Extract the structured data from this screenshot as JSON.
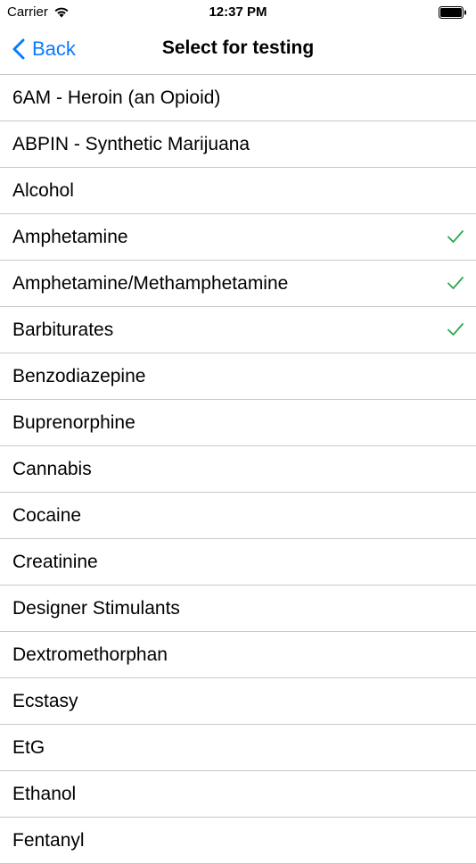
{
  "status_bar": {
    "carrier": "Carrier",
    "time": "12:37 PM"
  },
  "nav": {
    "back_label": "Back",
    "title": "Select for testing"
  },
  "colors": {
    "accent": "#0a7aff",
    "check": "#2aa84a",
    "separator": "#c8c7cc"
  },
  "items": [
    {
      "label": "6AM - Heroin (an Opioid)",
      "selected": false
    },
    {
      "label": "ABPIN - Synthetic Marijuana",
      "selected": false
    },
    {
      "label": "Alcohol",
      "selected": false
    },
    {
      "label": "Amphetamine",
      "selected": true
    },
    {
      "label": "Amphetamine/Methamphetamine",
      "selected": true
    },
    {
      "label": "Barbiturates",
      "selected": true
    },
    {
      "label": "Benzodiazepine",
      "selected": false
    },
    {
      "label": "Buprenorphine",
      "selected": false
    },
    {
      "label": "Cannabis",
      "selected": false
    },
    {
      "label": "Cocaine",
      "selected": false
    },
    {
      "label": "Creatinine",
      "selected": false
    },
    {
      "label": "Designer Stimulants",
      "selected": false
    },
    {
      "label": "Dextromethorphan",
      "selected": false
    },
    {
      "label": "Ecstasy",
      "selected": false
    },
    {
      "label": "EtG",
      "selected": false
    },
    {
      "label": "Ethanol",
      "selected": false
    },
    {
      "label": "Fentanyl",
      "selected": false
    }
  ]
}
